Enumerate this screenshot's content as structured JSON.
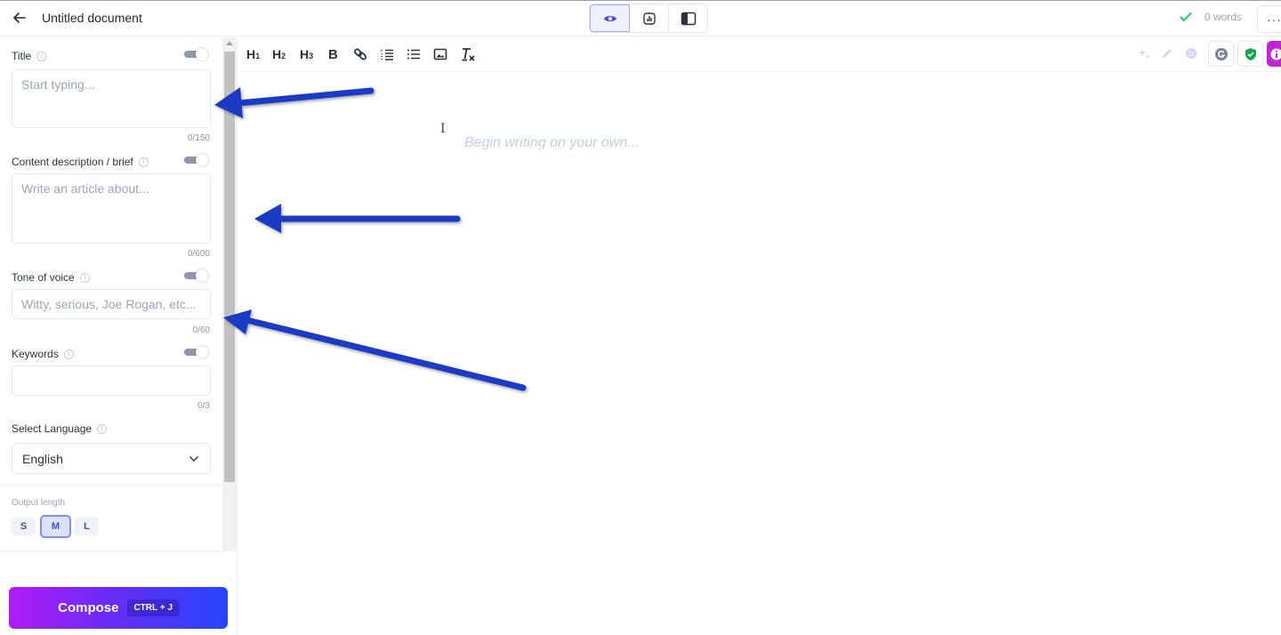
{
  "header": {
    "title": "Untitled document",
    "word_count": "0 words",
    "more_label": "···",
    "view_modes": [
      {
        "name": "preview",
        "icon": "eye-icon",
        "active": true
      },
      {
        "name": "analytics",
        "icon": "chart-icon",
        "active": false
      },
      {
        "name": "sidebar-layout",
        "icon": "sidebar-layout-icon",
        "active": false
      }
    ]
  },
  "sidebar": {
    "fields": [
      {
        "label": "Title",
        "placeholder": "Start typing...",
        "counter": "0/150",
        "toggle_on": true
      },
      {
        "label": "Content description / brief",
        "placeholder": "Write an article about...",
        "counter": "0/600",
        "toggle_on": true
      },
      {
        "label": "Tone of voice",
        "placeholder": "Witty, serious, Joe Rogan, etc...",
        "counter": "0/60",
        "toggle_on": true
      },
      {
        "label": "Keywords",
        "placeholder": "",
        "counter": "0/3",
        "toggle_on": true
      }
    ],
    "language": {
      "label": "Select Language",
      "value": "English"
    },
    "output_length": {
      "label": "Output length",
      "options": [
        "S",
        "M",
        "L"
      ],
      "selected": "M"
    },
    "compose": {
      "label": "Compose",
      "shortcut": "CTRL + J"
    }
  },
  "toolbar": {
    "h1": "H",
    "h1_sub": "1",
    "h2": "H",
    "h2_sub": "2",
    "h3": "H",
    "h3_sub": "3",
    "bold": "B",
    "items": [
      "heading-1",
      "heading-2",
      "heading-3",
      "bold",
      "link",
      "ordered-list",
      "bullet-list",
      "image",
      "clear-format"
    ]
  },
  "editor": {
    "placeholder": "Begin writing on your own...",
    "cursor": "I"
  },
  "colors": {
    "accent": "#4f46e5",
    "compose_gradient_start": "#b01cf5",
    "compose_gradient_end": "#2545fb",
    "annotation_arrow": "#1f3bc4",
    "success": "#22c55e"
  }
}
